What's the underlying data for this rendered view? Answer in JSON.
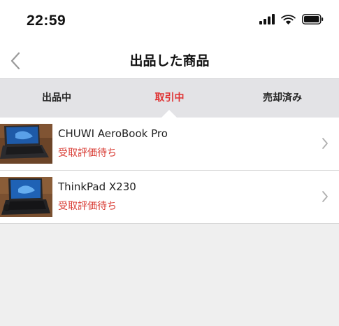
{
  "status_bar": {
    "time": "22:59",
    "icons": [
      "signal-icon",
      "wifi-icon",
      "battery-icon"
    ]
  },
  "nav": {
    "back_icon": "chevron-left-icon",
    "title": "出品した商品"
  },
  "tabs": [
    {
      "label": "出品中",
      "active": false
    },
    {
      "label": "取引中",
      "active": true
    },
    {
      "label": "売却済み",
      "active": false
    }
  ],
  "items": [
    {
      "title": "CHUWI AeroBook Pro",
      "status": "受取評価待ち",
      "image": "laptop-photo"
    },
    {
      "title": "ThinkPad X230",
      "status": "受取評価待ち",
      "image": "laptop-photo"
    }
  ],
  "colors": {
    "accent": "#e03434",
    "status_text": "#d83a32",
    "tab_bar": "#e3e3e6",
    "background": "#efefef"
  }
}
